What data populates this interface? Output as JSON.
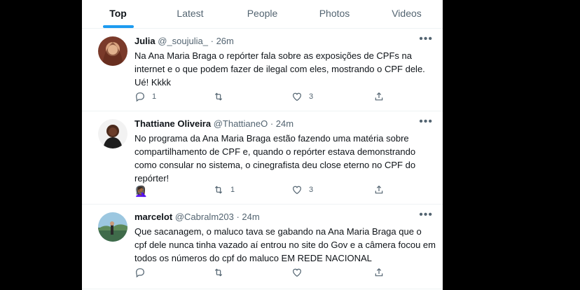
{
  "tabs": [
    "Top",
    "Latest",
    "People",
    "Photos",
    "Videos"
  ],
  "tweets": [
    {
      "name": "Julia",
      "handle": "@_soujulia_",
      "time": "· 26m",
      "text": "Na Ana Maria Braga o repórter fala sobre as exposições de CPFs na internet e o que podem fazer de ilegal com eles, mostrando o CPF dele. Ué! Kkkk",
      "emoji": "",
      "replies": "1",
      "retweets": "",
      "likes": "3"
    },
    {
      "name": "Thattiane Oliveira",
      "handle": "@ThattianeO",
      "time": "· 24m",
      "text": "No programa da Ana Maria Braga estão fazendo uma matéria sobre compartilhamento de CPF e, quando o repórter estava demonstrando como consular no sistema, o cinegrafista deu close eterno no CPF do repórter!",
      "emoji": "🤦🏾‍♀️",
      "replies": "",
      "retweets": "1",
      "likes": "3"
    },
    {
      "name": "marcelot",
      "handle": "@Cabralm203",
      "time": "· 24m",
      "text": "Que sacanagem, o maluco tava se gabando na Ana Maria Braga que o cpf dele nunca tinha vazado aí entrou no site do Gov e a câmera focou em todos os números do cpf do maluco EM REDE NACIONAL",
      "emoji": "",
      "replies": "",
      "retweets": "",
      "likes": ""
    }
  ],
  "icons": {
    "more": "more-horizontal-icon",
    "reply": "reply-icon",
    "retweet": "retweet-icon",
    "like": "heart-icon",
    "share": "share-icon"
  },
  "colors": {
    "accent": "#1d9bf0",
    "muted": "#536471",
    "text": "#0f1419"
  }
}
